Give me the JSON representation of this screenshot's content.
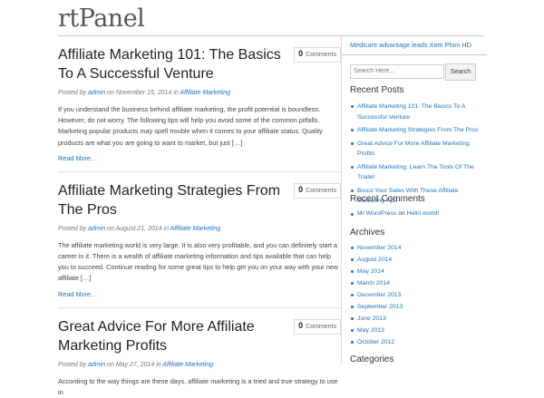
{
  "site": {
    "logo": "rtPanel"
  },
  "posts": [
    {
      "title": "Affiliate Marketing 101: The Basics To A Successful Venture",
      "comments_count": "0",
      "comments_label": "Comments",
      "meta_prefix": "Posted by",
      "author": "admin",
      "date": "on November 15, 2014 in",
      "category": "Affiliate Marketing",
      "excerpt": "If you understand the business behind affiliate marketing, the profit potential is boundless. However, do not worry. The following tips will help you avoid some of the common pitfalls. Marketing popular products may spell trouble when it comes to your affiliate status. Quality products are what you are going to want to market, but just […]",
      "more": "Read More…"
    },
    {
      "title": "Affiliate Marketing Strategies From The Pros",
      "comments_count": "0",
      "comments_label": "Comments",
      "meta_prefix": "Posted by",
      "author": "admin",
      "date": "on August 21, 2014 in",
      "category": "Affiliate Marketing",
      "excerpt": "The affiliate marketing world is very large. It is also very profitable, and you can definitely start a career in it. There is a wealth of affiliate marketing information and tips available that can help you to succeed. Continue reading for some great tips to help get you on your way with your new affiliate […]",
      "more": "Read More…"
    },
    {
      "title": "Great Advice For More Affiliate Marketing Profits",
      "comments_count": "0",
      "comments_label": "Comments",
      "meta_prefix": "Posted by",
      "author": "admin",
      "date": "on May 27, 2014 in",
      "category": "Affiliate Marketing",
      "excerpt": "According to the way things are these days, affiliate marketing is a tried and true strategy to use in",
      "more": ""
    }
  ],
  "sidebar": {
    "ad_link": "Medicare advantage leads Xem Phim HD",
    "search_placeholder": "Search Here...",
    "search_button": "Search",
    "recent_posts_title": "Recent Posts",
    "recent_posts": [
      "Affiliate Marketing 101: The Basics To A Successful Venture",
      "Affiliate Marketing Strategies From The Pros",
      "Great Advice For More Affiliate Marketing Profits",
      "Affiliate Marketing: Learn The Tools Of The Trade!",
      "Boost Your Sales With These Affiliate Marketing Tips"
    ],
    "recent_comments_title": "Recent Comments",
    "recent_comment": {
      "author": "Mr WordPress",
      "on": "on",
      "post": "Hello world!"
    },
    "archives_title": "Archives",
    "archives": [
      "November 2014",
      "August 2014",
      "May 2014",
      "March 2014",
      "December 2013",
      "September 2013",
      "June 2013",
      "May 2013",
      "October 2012"
    ],
    "categories_title": "Categories"
  }
}
